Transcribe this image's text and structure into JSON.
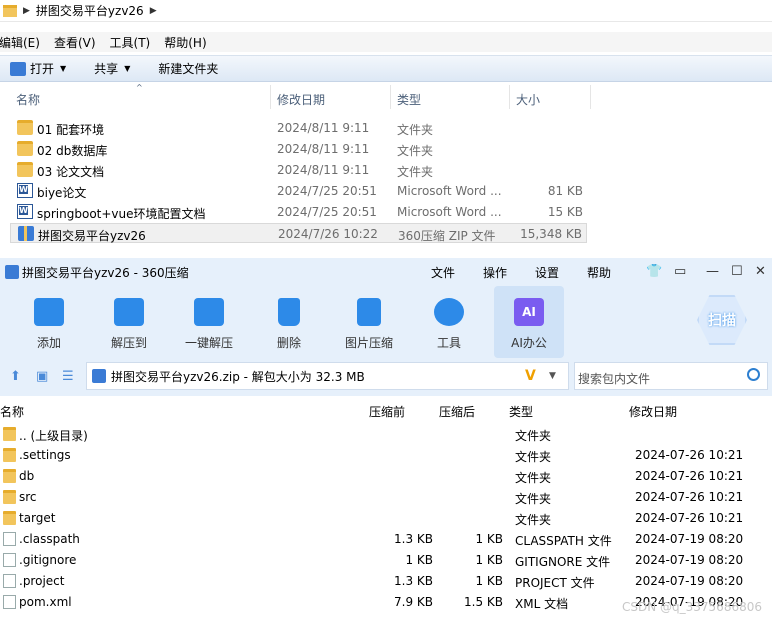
{
  "explorer": {
    "breadcrumb": "拼图交易平台yzv26",
    "menu": [
      "编辑(E)",
      "查看(V)",
      "工具(T)",
      "帮助(H)"
    ],
    "toolbar": {
      "open": "打开",
      "share": "共享",
      "new_folder": "新建文件夹"
    },
    "columns": {
      "name": "名称",
      "date": "修改日期",
      "type": "类型",
      "size": "大小"
    },
    "files": [
      {
        "name": "01 配套环境",
        "date": "2024/8/11 9:11",
        "type": "文件夹",
        "size": "",
        "icon": "folder-icon"
      },
      {
        "name": "02 db数据库",
        "date": "2024/8/11 9:11",
        "type": "文件夹",
        "size": "",
        "icon": "folder-icon"
      },
      {
        "name": "03 论文文档",
        "date": "2024/8/11 9:11",
        "type": "文件夹",
        "size": "",
        "icon": "folder-icon"
      },
      {
        "name": "biye论文",
        "date": "2024/7/25 20:51",
        "type": "Microsoft Word ...",
        "size": "81 KB",
        "icon": "word-icon"
      },
      {
        "name": "springboot+vue环境配置文档",
        "date": "2024/7/25 20:51",
        "type": "Microsoft Word ...",
        "size": "15 KB",
        "icon": "word-icon"
      },
      {
        "name": "拼图交易平台yzv26",
        "date": "2024/7/26 10:22",
        "type": "360压缩 ZIP 文件",
        "size": "15,348 KB",
        "icon": "zip-icon",
        "selected": true
      }
    ]
  },
  "zip": {
    "title": "拼图交易平台yzv26 - 360压缩",
    "menu": [
      "文件",
      "操作",
      "设置",
      "帮助"
    ],
    "tools": [
      "添加",
      "解压到",
      "一键解压",
      "删除",
      "图片压缩",
      "工具",
      "AI办公"
    ],
    "scan_label": "扫描",
    "path_text": "拼图交易平台yzv26.zip - 解包大小为 32.3 MB",
    "search_placeholder": "搜索包内文件",
    "columns": {
      "name": "名称",
      "before": "压缩前",
      "after": "压缩后",
      "type": "类型",
      "date": "修改日期"
    },
    "rows": [
      {
        "name": ".. (上级目录)",
        "before": "",
        "after": "",
        "type": "文件夹",
        "date": "",
        "icon": "folder-icon"
      },
      {
        "name": ".settings",
        "before": "",
        "after": "",
        "type": "文件夹",
        "date": "2024-07-26 10:21",
        "icon": "folder-icon"
      },
      {
        "name": "db",
        "before": "",
        "after": "",
        "type": "文件夹",
        "date": "2024-07-26 10:21",
        "icon": "folder-icon"
      },
      {
        "name": "src",
        "before": "",
        "after": "",
        "type": "文件夹",
        "date": "2024-07-26 10:21",
        "icon": "folder-icon"
      },
      {
        "name": "target",
        "before": "",
        "after": "",
        "type": "文件夹",
        "date": "2024-07-26 10:21",
        "icon": "folder-icon"
      },
      {
        "name": ".classpath",
        "before": "1.3 KB",
        "after": "1 KB",
        "type": "CLASSPATH 文件",
        "date": "2024-07-19 08:20",
        "icon": "file-icon"
      },
      {
        "name": ".gitignore",
        "before": "1 KB",
        "after": "1 KB",
        "type": "GITIGNORE 文件",
        "date": "2024-07-19 08:20",
        "icon": "file-icon"
      },
      {
        "name": ".project",
        "before": "1.3 KB",
        "after": "1 KB",
        "type": "PROJECT 文件",
        "date": "2024-07-19 08:20",
        "icon": "file-icon"
      },
      {
        "name": "pom.xml",
        "before": "7.9 KB",
        "after": "1.5 KB",
        "type": "XML 文档",
        "date": "2024-07-19 08:20",
        "icon": "file-icon"
      }
    ]
  },
  "watermark": "CSDN @q_3375686806"
}
